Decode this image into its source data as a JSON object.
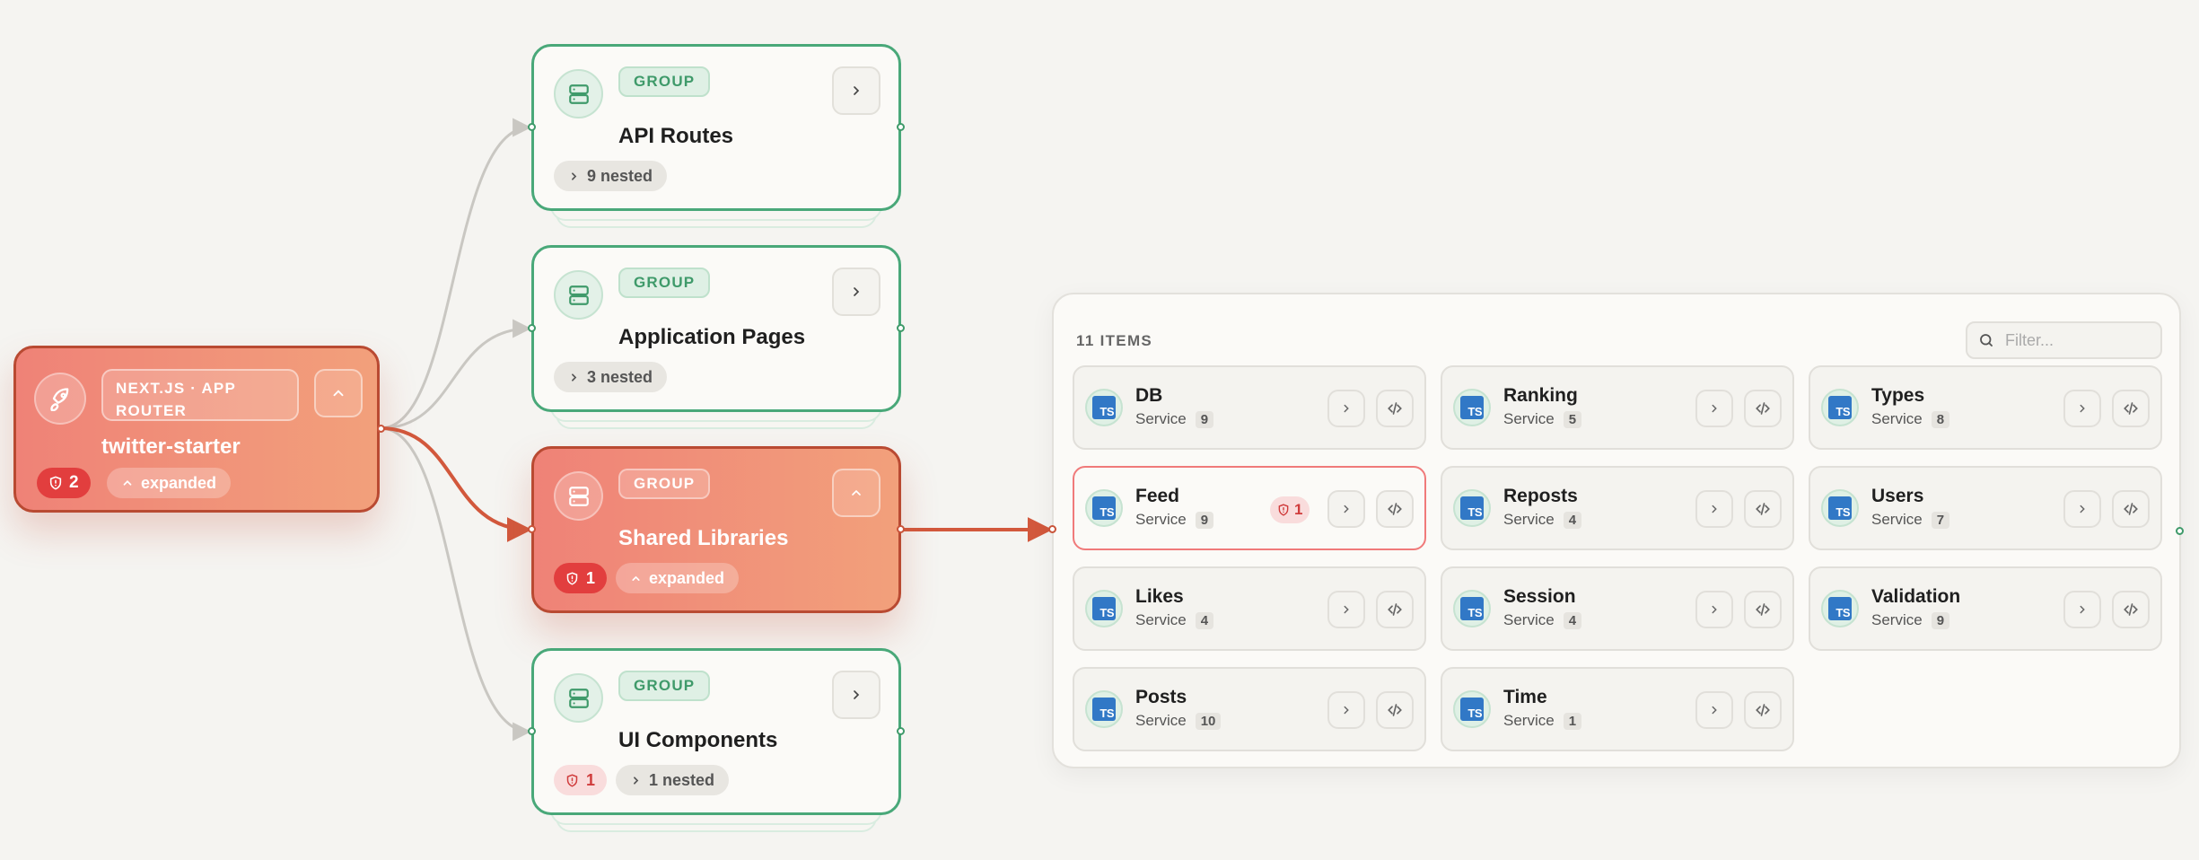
{
  "root": {
    "type_label": "NEXT.JS · APP ROUTER",
    "title": "twitter-starter",
    "alerts": "2",
    "state": "expanded",
    "icon": "rocket-icon"
  },
  "groups": [
    {
      "badge": "GROUP",
      "title": "API Routes",
      "nested": "9 nested"
    },
    {
      "badge": "GROUP",
      "title": "Application Pages",
      "nested": "3 nested"
    },
    {
      "badge": "GROUP",
      "title": "Shared Libraries",
      "alerts": "1",
      "state": "expanded"
    },
    {
      "badge": "GROUP",
      "title": "UI Components",
      "alerts": "1",
      "nested": "1 nested"
    }
  ],
  "panel": {
    "count_label": "11 ITEMS",
    "filter_placeholder": "Filter...",
    "items": [
      {
        "name": "DB",
        "type": "Service",
        "count": "9"
      },
      {
        "name": "Ranking",
        "type": "Service",
        "count": "5"
      },
      {
        "name": "Types",
        "type": "Service",
        "count": "8"
      },
      {
        "name": "Feed",
        "type": "Service",
        "count": "9",
        "alerts": "1"
      },
      {
        "name": "Reposts",
        "type": "Service",
        "count": "4"
      },
      {
        "name": "Users",
        "type": "Service",
        "count": "7"
      },
      {
        "name": "Likes",
        "type": "Service",
        "count": "4"
      },
      {
        "name": "Session",
        "type": "Service",
        "count": "4"
      },
      {
        "name": "Validation",
        "type": "Service",
        "count": "9"
      },
      {
        "name": "Posts",
        "type": "Service",
        "count": "10"
      },
      {
        "name": "Time",
        "type": "Service",
        "count": "1"
      }
    ],
    "ts_label": "TS"
  },
  "colors": {
    "accent_green": "#49a879",
    "accent_red": "#b94a32",
    "alert_red": "#e23e3e",
    "edge_gray": "#c9c7c2",
    "edge_active": "#d2583c"
  }
}
